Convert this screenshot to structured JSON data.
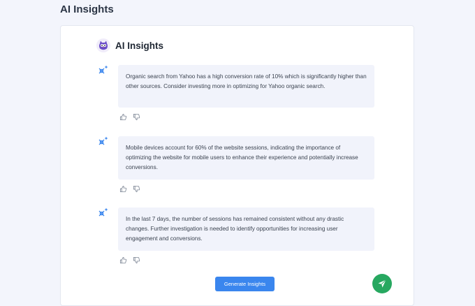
{
  "page": {
    "title": "AI Insights"
  },
  "card": {
    "title": "AI Insights"
  },
  "insights": [
    {
      "text": "Organic search from Yahoo has a high conversion rate of 10% which is significantly higher than other sources. Consider investing more in optimizing for Yahoo organic search."
    },
    {
      "text": "Mobile devices account for 60% of the website sessions, indicating the importance of optimizing the website for mobile users to enhance their experience and potentially increase conversions."
    },
    {
      "text": "In the last 7 days, the number of sessions has remained consistent without any drastic changes. Further investigation is needed to identify opportunities for increasing user engagement and conversions."
    }
  ],
  "actions": {
    "generate_label": "Generate Insights"
  },
  "icons": {
    "logo": "owl-logo-icon",
    "insight": "ai-sparkle-icon",
    "like": "thumbs-up-icon",
    "dislike": "thumbs-down-icon",
    "send": "send-icon"
  },
  "colors": {
    "primary": "#3a86ee",
    "send": "#27a860",
    "bubble": "#f1f3fb",
    "background": "#f3f5fc"
  }
}
